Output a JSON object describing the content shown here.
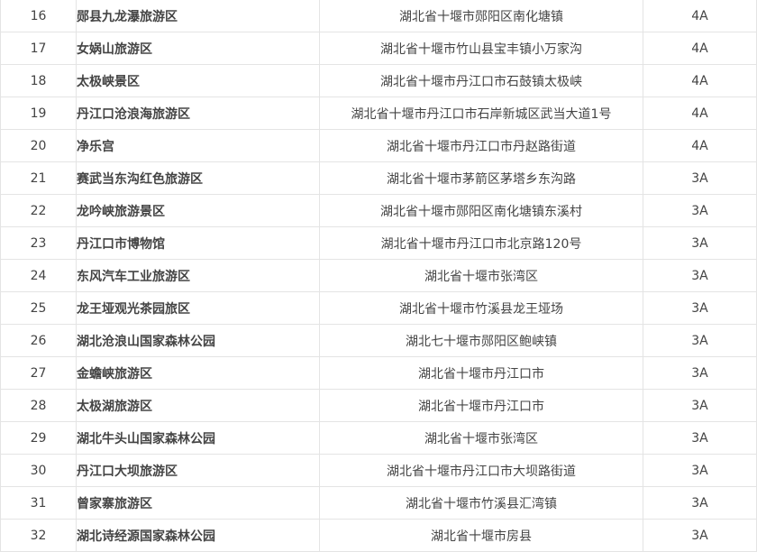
{
  "table": {
    "rows": [
      {
        "no": "16",
        "name": "郧县九龙瀑旅游区",
        "address": "湖北省十堰市郧阳区南化塘镇",
        "grade": "4A"
      },
      {
        "no": "17",
        "name": "女娲山旅游区",
        "address": "湖北省十堰市竹山县宝丰镇小万家沟",
        "grade": "4A"
      },
      {
        "no": "18",
        "name": "太极峡景区",
        "address": "湖北省十堰市丹江口市石鼓镇太极峡",
        "grade": "4A"
      },
      {
        "no": "19",
        "name": "丹江口沧浪海旅游区",
        "address": "湖北省十堰市丹江口市石岸新城区武当大道1号",
        "grade": "4A"
      },
      {
        "no": "20",
        "name": "净乐宫",
        "address": "湖北省十堰市丹江口市丹赵路街道",
        "grade": "4A"
      },
      {
        "no": "21",
        "name": "赛武当东沟红色旅游区",
        "address": "湖北省十堰市茅箭区茅塔乡东沟路",
        "grade": "3A"
      },
      {
        "no": "22",
        "name": "龙吟峡旅游景区",
        "address": "湖北省十堰市郧阳区南化塘镇东溪村",
        "grade": "3A"
      },
      {
        "no": "23",
        "name": "丹江口市博物馆",
        "address": "湖北省十堰市丹江口市北京路120号",
        "grade": "3A"
      },
      {
        "no": "24",
        "name": "东风汽车工业旅游区",
        "address": "湖北省十堰市张湾区",
        "grade": "3A"
      },
      {
        "no": "25",
        "name": "龙王垭观光茶园旅区",
        "address": "湖北省十堰市竹溪县龙王垭场",
        "grade": "3A"
      },
      {
        "no": "26",
        "name": "湖北沧浪山国家森林公园",
        "address": "湖北七十堰市郧阳区鲍峡镇",
        "grade": "3A"
      },
      {
        "no": "27",
        "name": "金蟾峡旅游区",
        "address": "湖北省十堰市丹江口市",
        "grade": "3A"
      },
      {
        "no": "28",
        "name": "太极湖旅游区",
        "address": "湖北省十堰市丹江口市",
        "grade": "3A"
      },
      {
        "no": "29",
        "name": "湖北牛头山国家森林公园",
        "address": "湖北省十堰市张湾区",
        "grade": "3A"
      },
      {
        "no": "30",
        "name": "丹江口大坝旅游区",
        "address": "湖北省十堰市丹江口市大坝路街道",
        "grade": "3A"
      },
      {
        "no": "31",
        "name": "曾家寨旅游区",
        "address": "湖北省十堰市竹溪县汇湾镇",
        "grade": "3A"
      },
      {
        "no": "32",
        "name": "湖北诗经源国家森林公园",
        "address": "湖北省十堰市房县",
        "grade": "3A"
      }
    ]
  },
  "colors": {
    "name_text": "#1f3f72",
    "body_text": "#444444",
    "grid_line": "#e4e4e4"
  }
}
